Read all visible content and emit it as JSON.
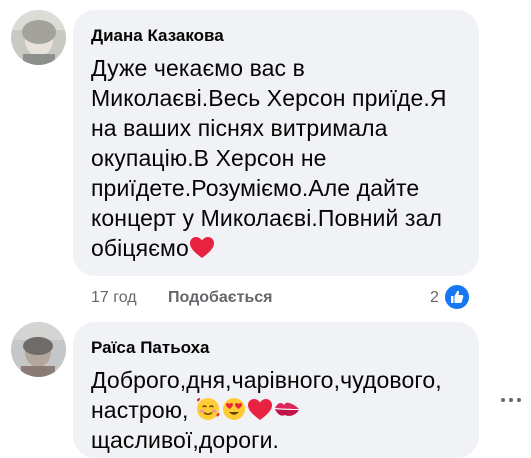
{
  "comments": [
    {
      "author": "Диана Казакова",
      "lines": [
        "Дуже чекаємо вас в",
        "Миколаєві.Весь Херсон приїде.Я",
        "на ваших піснях витримала",
        "окупацію.В Херсон не",
        "приїдете.Розуміємо.Але дайте",
        "концерт у Миколаєві.Повний зал",
        "обіцяємо"
      ],
      "trailing_emoji": "red-heart-emoji",
      "time": "17 год",
      "like_label": "Подобається",
      "reaction_count": "2",
      "reaction_icon": "thumbs-up-icon"
    },
    {
      "author": "Раїса Патьоха",
      "lines": [
        "Доброго,дня,чарівного,чудового,",
        "настрою,",
        "щасливої,дороги."
      ],
      "emojis": [
        "smiling-face-with-hearts-emoji",
        "heart-eyes-emoji",
        "red-heart-emoji",
        "kiss-mark-emoji"
      ]
    }
  ],
  "colors": {
    "bubble": "#f0f2f5",
    "meta_text": "#65676b",
    "like_blue": "#1877f2",
    "heart_red": "#e8233f"
  },
  "icons": [
    "more-options-icon"
  ]
}
